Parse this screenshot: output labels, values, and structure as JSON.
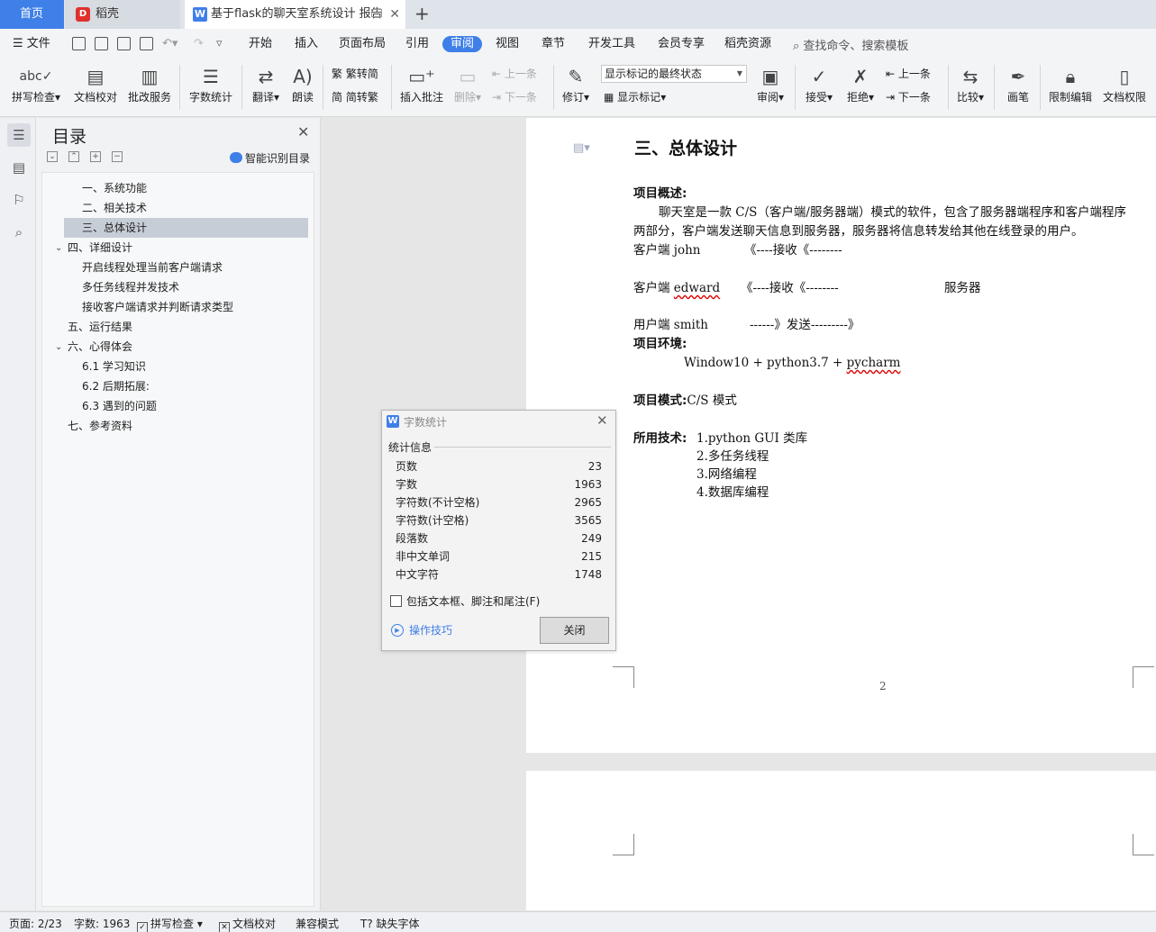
{
  "tabs": {
    "home": "首页",
    "daoke": "稻壳",
    "doc": "基于flask的聊天室系统设计 报告",
    "close": "✕",
    "add": "+"
  },
  "menu": {
    "file": "文件",
    "items": [
      "开始",
      "插入",
      "页面布局",
      "引用",
      "审阅",
      "视图",
      "章节",
      "开发工具",
      "会员专享",
      "稻壳资源"
    ],
    "active": "审阅",
    "search": "查找命令、搜索模板"
  },
  "ribbon": {
    "spell": "拼写检查",
    "proof": "文档校对",
    "correct": "批改服务",
    "wordcount": "字数统计",
    "translate": "翻译",
    "read": "朗读",
    "trad": "繁转简",
    "simp": "简转繁",
    "insert_comment": "插入批注",
    "delete": "删除",
    "prev_comment": "上一条",
    "next_comment": "下一条",
    "revise": "修订",
    "markup_combo": "显示标记的最终状态",
    "show_markup": "显示标记",
    "review": "审阅",
    "accept": "接受",
    "reject": "拒绝",
    "prev_change": "上一条",
    "next_change": "下一条",
    "compare": "比较",
    "ink": "画笔",
    "restrict": "限制编辑",
    "rights": "文档权限"
  },
  "toc": {
    "title": "目录",
    "smart": "智能识别目录",
    "items": [
      {
        "label": "一、系统功能",
        "level": 2
      },
      {
        "label": "二、相关技术",
        "level": 2
      },
      {
        "label": "三、总体设计",
        "level": 2,
        "selected": true
      },
      {
        "label": "四、详细设计",
        "level": 1,
        "expanded": true
      },
      {
        "label": "开启线程处理当前客户端请求",
        "level": 2
      },
      {
        "label": "多任务线程并发技术",
        "level": 2
      },
      {
        "label": "接收客户端请求并判断请求类型",
        "level": 2
      },
      {
        "label": "五、运行结果",
        "level": 1
      },
      {
        "label": "六、心得体会",
        "level": 1,
        "expanded": true
      },
      {
        "label": "6.1  学习知识",
        "level": 2
      },
      {
        "label": "6.2  后期拓展:",
        "level": 2
      },
      {
        "label": "6.3  遇到的问题",
        "level": 2
      },
      {
        "label": "七、参考资料",
        "level": 1
      }
    ]
  },
  "document": {
    "heading": "三、总体设计",
    "overview_label": "项目概述:",
    "overview_line1": "聊天室是一款 C/S（客户端/服务器端）模式的软件，包含了服务器端程序和客户端程序",
    "overview_line2": "两部分，客户端发送聊天信息到服务器，服务器将信息转发给其他在线登录的用户。",
    "client_john": "客户端  john",
    "recv1": "《----接收《--------",
    "client_edward_prefix": "客户端  ",
    "client_edward_name": "edward",
    "recv2": "《----接收《--------",
    "server": "服务器",
    "user_smith": "用户端  smith",
    "send": "------》发送---------》",
    "env_label": "项目环境:",
    "env_value_prefix": "Window10 + python3.7 + ",
    "env_value_pycharm": "pycharm",
    "mode_label": "项目模式:",
    "mode_value": "C/S 模式",
    "tech_label": "所用技术:",
    "tech_items": [
      "1.python GUI  类库",
      "2.多任务线程",
      "3.网络编程",
      "4.数据库编程"
    ],
    "page_number": "2"
  },
  "dialog": {
    "title": "字数统计",
    "group": "统计信息",
    "rows": [
      {
        "label": "页数",
        "value": "23"
      },
      {
        "label": "字数",
        "value": "1963"
      },
      {
        "label": "字符数(不计空格)",
        "value": "2965"
      },
      {
        "label": "字符数(计空格)",
        "value": "3565"
      },
      {
        "label": "段落数",
        "value": "249"
      },
      {
        "label": "非中文单词",
        "value": "215"
      },
      {
        "label": "中文字符",
        "value": "1748"
      }
    ],
    "checkbox": "包括文本框、脚注和尾注(F)",
    "tips": "操作技巧",
    "close_button": "关闭"
  },
  "status": {
    "page": "页面: 2/23",
    "words": "字数: 1963",
    "spell": "拼写检查",
    "proof": "文档校对",
    "compat": "兼容模式",
    "missing_font": "缺失字体"
  },
  "colors": {
    "accent": "#3f7fe8",
    "wps_red": "#e0312e"
  }
}
